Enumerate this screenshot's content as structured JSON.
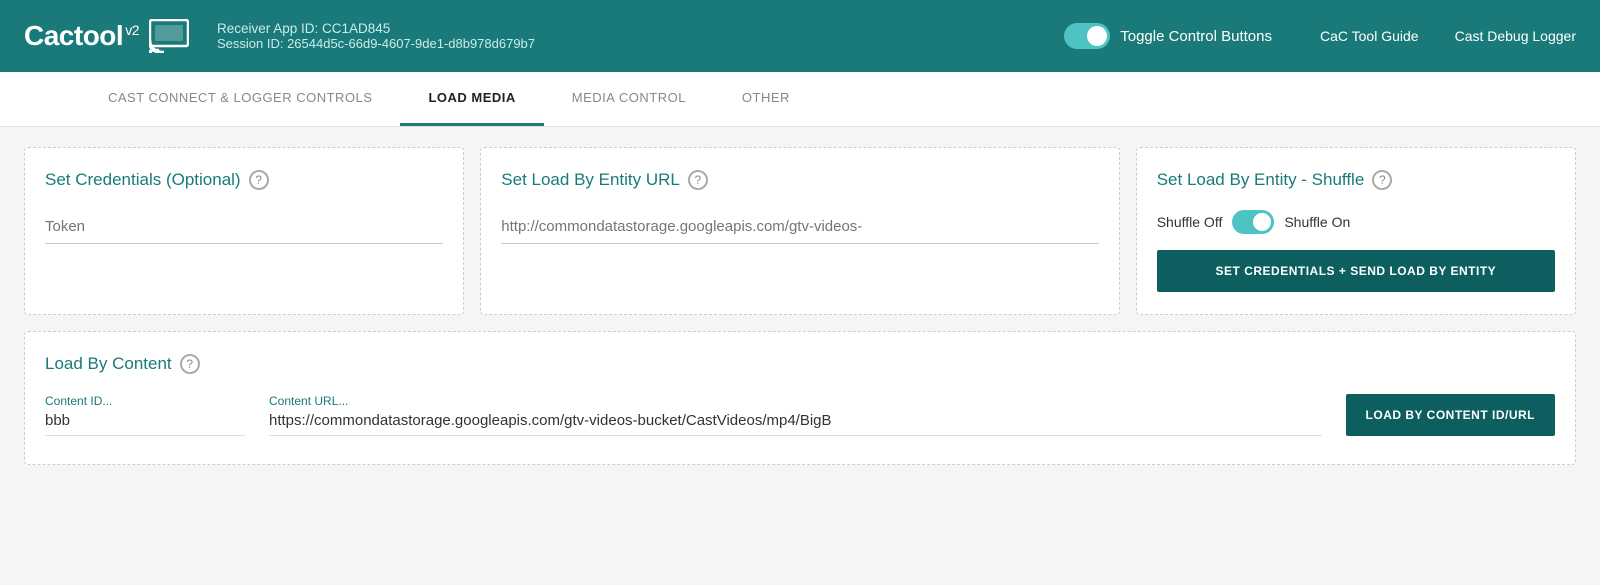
{
  "header": {
    "logo_text": "Cactool",
    "logo_v2": "v2",
    "receiver_label": "Receiver App ID: CC1AD845",
    "session_label": "Session ID: 26544d5c-66d9-4607-9de1-d8b978d679b7",
    "toggle_label": "Toggle Control Buttons",
    "link_guide": "CaC Tool Guide",
    "link_logger": "Cast Debug Logger"
  },
  "tabs": [
    {
      "id": "cast-connect",
      "label": "CAST CONNECT & LOGGER CONTROLS",
      "active": false
    },
    {
      "id": "load-media",
      "label": "LOAD MEDIA",
      "active": true
    },
    {
      "id": "media-control",
      "label": "MEDIA CONTROL",
      "active": false
    },
    {
      "id": "other",
      "label": "OTHER",
      "active": false
    }
  ],
  "panels": {
    "credentials": {
      "title": "Set Credentials (Optional)",
      "token_placeholder": "Token"
    },
    "entity_url": {
      "title": "Set Load By Entity URL",
      "url_placeholder": "http://commondatastorage.googleapis.com/gtv-videos-"
    },
    "shuffle": {
      "title": "Set Load By Entity - Shuffle",
      "shuffle_off_label": "Shuffle Off",
      "shuffle_on_label": "Shuffle On",
      "button_label": "SET CREDENTIALS + SEND LOAD BY ENTITY"
    }
  },
  "load_by_content": {
    "title": "Load By Content",
    "content_id_label": "Content ID...",
    "content_id_value": "bbb",
    "content_url_label": "Content URL...",
    "content_url_value": "https://commondatastorage.googleapis.com/gtv-videos-bucket/CastVideos/mp4/BigB",
    "button_label": "LOAD BY CONTENT ID/URL"
  },
  "colors": {
    "teal": "#1a7a7a",
    "dark_teal": "#0d5f5f",
    "toggle_blue": "#4fc3c3"
  },
  "icons": {
    "help": "?",
    "cast": "⊡"
  }
}
